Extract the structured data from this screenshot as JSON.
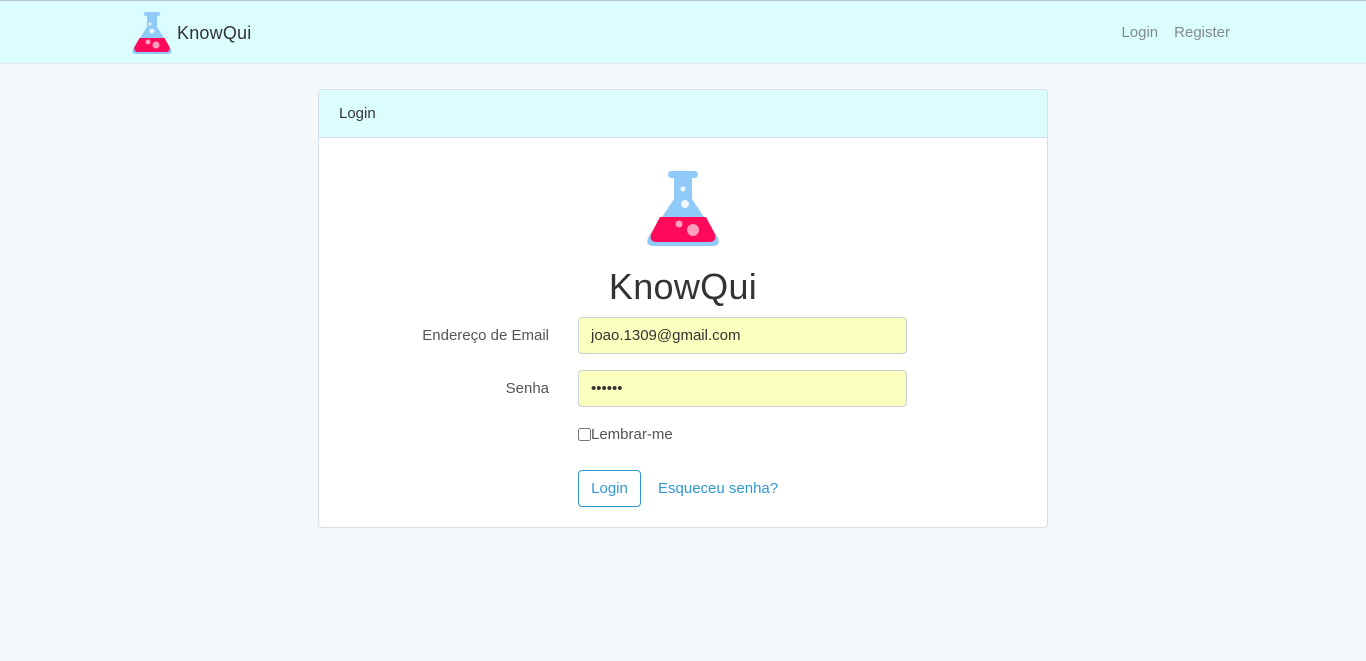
{
  "navbar": {
    "brand": "KnowQui",
    "links": [
      {
        "label": "Login"
      },
      {
        "label": "Register"
      }
    ]
  },
  "card": {
    "header": "Login",
    "title": "KnowQui",
    "email": {
      "label": "Endereço de Email",
      "value": "joao.1309@gmail.com"
    },
    "password": {
      "label": "Senha",
      "value": "••••••"
    },
    "remember": {
      "label": "Lembrar-me",
      "checked": false
    },
    "login_button": "Login",
    "forgot_link": "Esqueceu senha?"
  },
  "icons": {
    "logo": "flask-icon"
  },
  "colors": {
    "navbar_bg": "#dcfdff",
    "page_bg": "#f5f8fa",
    "autofill_bg": "#faffbd",
    "link": "#3097d1",
    "flask_glass": "#90caf9",
    "flask_liquid": "#ff0a5a"
  }
}
